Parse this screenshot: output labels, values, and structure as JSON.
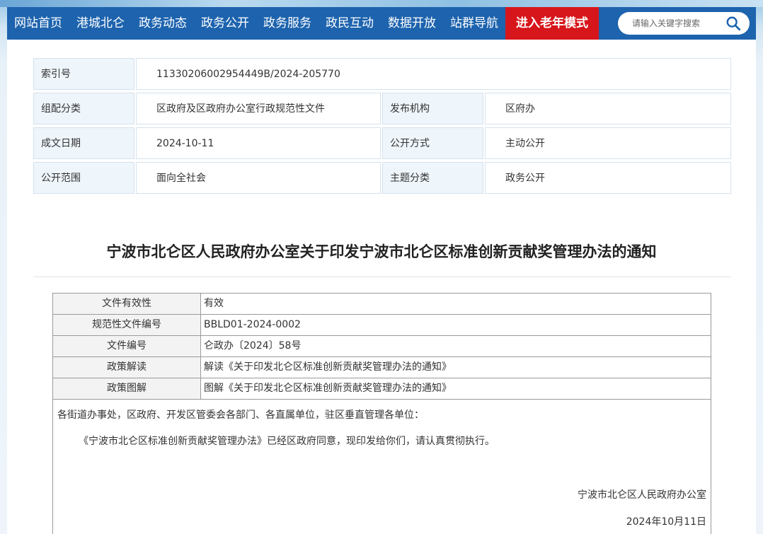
{
  "nav": {
    "items": [
      "网站首页",
      "港城北仑",
      "政务动态",
      "政务公开",
      "政务服务",
      "政民互动",
      "数据开放",
      "站群导航"
    ],
    "elder_mode": "进入老年模式",
    "search_placeholder": "请输入关键字搜索"
  },
  "meta": {
    "index_label": "索引号",
    "index_value": "11330206002954449B/2024-205770",
    "category_label": "组配分类",
    "category_value": "区政府及区政府办公室行政规范性文件",
    "publisher_label": "发布机构",
    "publisher_value": "区府办",
    "date_label": "成文日期",
    "date_value": "2024-10-11",
    "method_label": "公开方式",
    "method_value": "主动公开",
    "scope_label": "公开范围",
    "scope_value": "面向全社会",
    "topic_label": "主题分类",
    "topic_value": "政务公开"
  },
  "article": {
    "title": "宁波市北仑区人民政府办公室关于印发宁波市北仑区标准创新贡献奖管理办法的通知",
    "rows": [
      {
        "label": "文件有效性",
        "value": "有效"
      },
      {
        "label": "规范性文件编号",
        "value": "BBLD01-2024-0002"
      },
      {
        "label": "文件编号",
        "value": "仑政办〔2024〕58号"
      },
      {
        "label": "政策解读",
        "value": "解读《关于印发北仑区标准创新贡献奖管理办法的通知》"
      },
      {
        "label": "政策图解",
        "value": "图解《关于印发北仑区标准创新贡献奖管理办法的通知》"
      }
    ],
    "salutation": "各街道办事处，区政府、开发区管委会各部门、各直属单位，驻区垂直管理各单位：",
    "paragraph": "《宁波市北仑区标准创新贡献奖管理办法》已经区政府同意，现印发给你们，请认真贯彻执行。",
    "signature": "宁波市北仑区人民政府办公室",
    "sign_date": "2024年10月11日"
  }
}
